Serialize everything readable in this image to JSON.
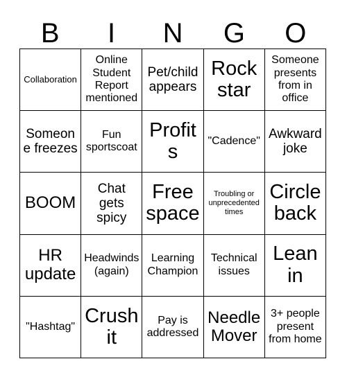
{
  "card": {
    "title": "BINGO Card",
    "header_letters": [
      "B",
      "I",
      "N",
      "G",
      "O"
    ],
    "grid_size": 5,
    "colors": {
      "background": "#ffffff",
      "text": "#000000",
      "border": "#000000"
    },
    "rows": [
      [
        {
          "text": "Collaboration",
          "size": "s"
        },
        {
          "text": "Online Student Report mentioned",
          "size": "m"
        },
        {
          "text": "Pet/child appears",
          "size": "l"
        },
        {
          "text": "Rock star",
          "size": "xxl"
        },
        {
          "text": "Someone presents from in office",
          "size": "m"
        }
      ],
      [
        {
          "text": "Someone freezes",
          "size": "l"
        },
        {
          "text": "Fun sportscoat",
          "size": "m"
        },
        {
          "text": "Profits",
          "size": "xxl"
        },
        {
          "text": "\"Cadence\"",
          "size": "m"
        },
        {
          "text": "Awkward joke",
          "size": "l"
        }
      ],
      [
        {
          "text": "BOOM",
          "size": "xl"
        },
        {
          "text": "Chat gets spicy",
          "size": "l"
        },
        {
          "text": "Free space",
          "size": "xxl"
        },
        {
          "text": "Troubling or unprecedented times",
          "size": "xs"
        },
        {
          "text": "Circle back",
          "size": "xxl"
        }
      ],
      [
        {
          "text": "HR update",
          "size": "xl"
        },
        {
          "text": "Headwinds (again)",
          "size": "m"
        },
        {
          "text": "Learning Champion",
          "size": "m"
        },
        {
          "text": "Technical issues",
          "size": "m"
        },
        {
          "text": "Lean in",
          "size": "xxl"
        }
      ],
      [
        {
          "text": "\"Hashtag\"",
          "size": "m"
        },
        {
          "text": "Crush it",
          "size": "xxl"
        },
        {
          "text": "Pay is addressed",
          "size": "m"
        },
        {
          "text": "Needle Mover",
          "size": "xl"
        },
        {
          "text": "3+ people present from home",
          "size": "m"
        }
      ]
    ]
  }
}
